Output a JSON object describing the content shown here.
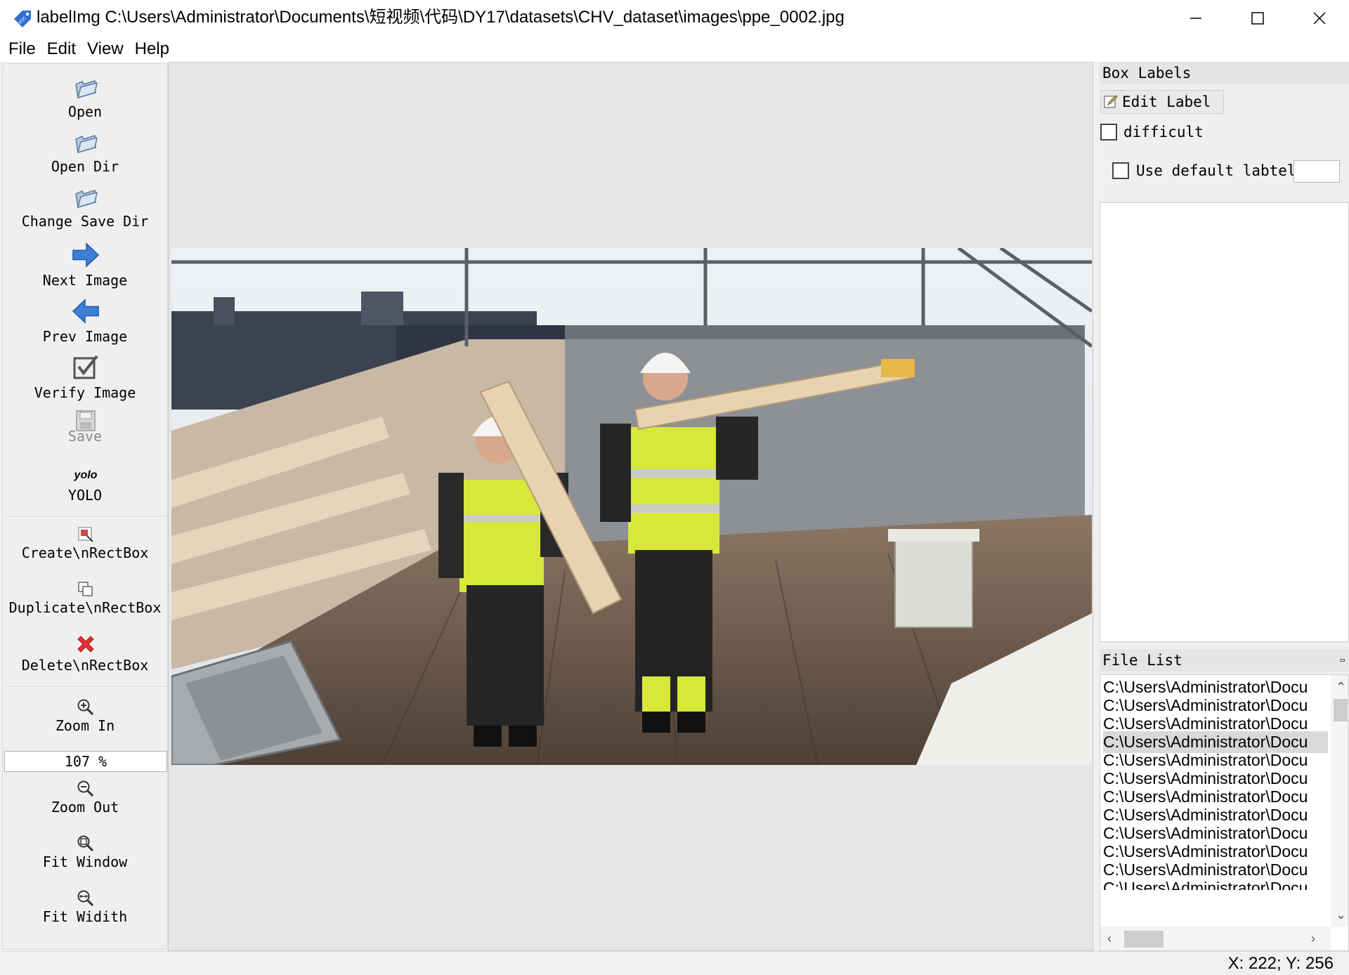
{
  "window": {
    "title": "labelImg C:\\Users\\Administrator\\Documents\\短视频\\代码\\DY17\\datasets\\CHV_dataset\\images\\ppe_0002.jpg",
    "app_icon_text": "VOC",
    "controls": [
      "minimize-icon",
      "maximize-icon",
      "close-icon"
    ]
  },
  "menu": [
    "File",
    "Edit",
    "View",
    "Help"
  ],
  "toolbar": {
    "open": "Open",
    "open_dir": "Open Dir",
    "change_save_dir": "Change Save Dir",
    "next_image": "Next Image",
    "prev_image": "Prev Image",
    "verify_image": "Verify Image",
    "save": "Save",
    "yolo_icon_text": "yolo",
    "yolo": "YOLO",
    "create_rect": "Create\\nRectBox",
    "duplicate_rect": "Duplicate\\nRectBox",
    "delete_rect": "Delete\\nRectBox",
    "zoom_in": "Zoom In",
    "zoom_value": "107 %",
    "zoom_out": "Zoom Out",
    "fit_window": "Fit Window",
    "fit_width": "Fit Widith"
  },
  "box_labels": {
    "title": "Box Labels",
    "edit_label": "Edit Label",
    "difficult": "difficult",
    "use_default_label": "Use default labtel",
    "default_label_value": "",
    "difficult_checked": false,
    "use_default_checked": false
  },
  "file_list": {
    "title": "File List",
    "items": [
      "C:\\Users\\Administrator\\Docu",
      "C:\\Users\\Administrator\\Docu",
      "C:\\Users\\Administrator\\Docu",
      "C:\\Users\\Administrator\\Docu",
      "C:\\Users\\Administrator\\Docu",
      "C:\\Users\\Administrator\\Docu",
      "C:\\Users\\Administrator\\Docu",
      "C:\\Users\\Administrator\\Docu",
      "C:\\Users\\Administrator\\Docu",
      "C:\\Users\\Administrator\\Docu",
      "C:\\Users\\Administrator\\Docu",
      "C:\\Users\\Administrator\\Docu"
    ],
    "selected_index": 3
  },
  "status": {
    "coords": "X: 222; Y: 256"
  },
  "colors": {
    "arrow_blue": "#3d7fd6",
    "delete_red": "#e0322f",
    "vest_yellow": "#d8e83a"
  }
}
